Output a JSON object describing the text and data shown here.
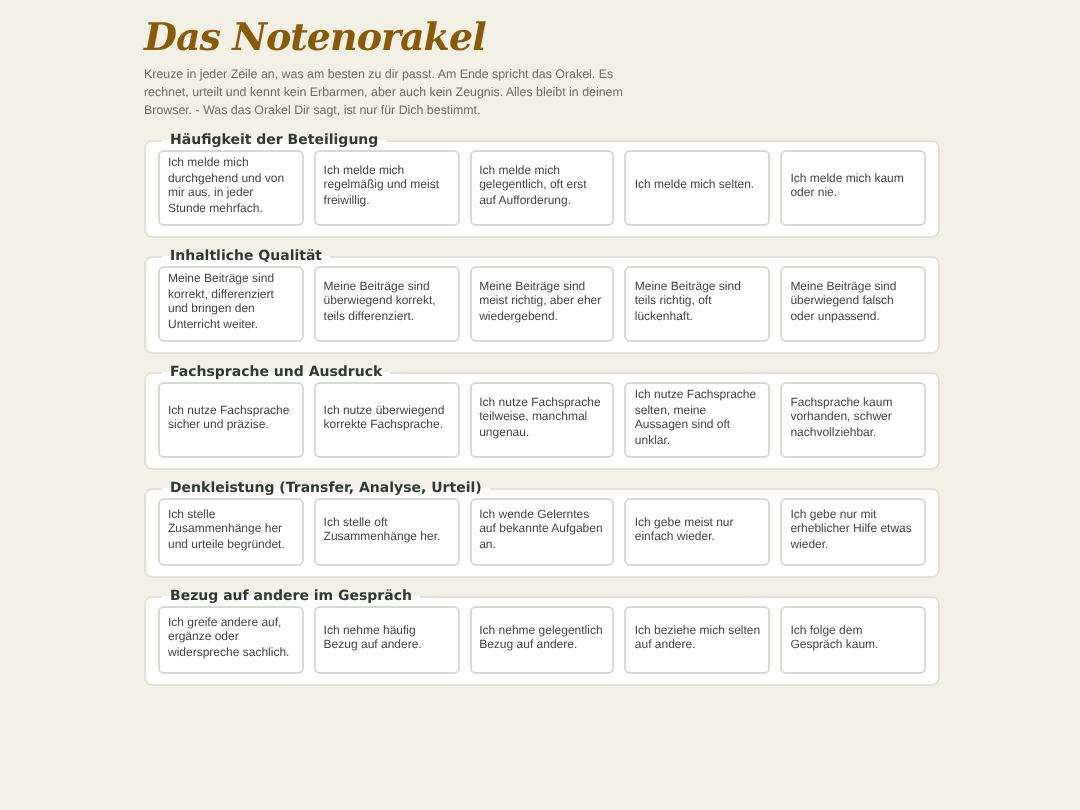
{
  "title": "Das Notenorakel",
  "intro": "Kreuze in jeder Zeile an, was am besten zu dir passt. Am Ende spricht das Orakel. Es rechnet, urteilt und kennt kein Erbarmen, aber auch kein Zeugnis. Alles bleibt in deinem Browser. - Was das Orakel Dir sagt, ist nur für Dich bestimmt.",
  "sections": [
    {
      "legend": "Häufigkeit der Beteiligung",
      "options": [
        {
          "text": "Ich melde mich durchgehend und von mir aus, in jeder Stunde mehrfach.",
          "selected": false
        },
        {
          "text": "Ich melde mich regelmäßig und meist freiwillig.",
          "selected": false
        },
        {
          "text": "Ich melde mich gelegentlich, oft erst auf Aufforderung.",
          "selected": false
        },
        {
          "text": "Ich melde mich selten.",
          "selected": false
        },
        {
          "text": "Ich melde mich kaum oder nie.",
          "selected": false
        }
      ]
    },
    {
      "legend": "Inhaltliche Qualität",
      "options": [
        {
          "text": "Meine Beiträge sind korrekt, differenziert und bringen den Unterricht weiter.",
          "selected": false
        },
        {
          "text": "Meine Beiträge sind überwiegend korrekt, teils differenziert.",
          "selected": false
        },
        {
          "text": "Meine Beiträge sind meist richtig, aber eher wiedergebend.",
          "selected": false
        },
        {
          "text": "Meine Beiträge sind teils richtig, oft lückenhaft.",
          "selected": false
        },
        {
          "text": "Meine Beiträge sind überwiegend falsch oder unpassend.",
          "selected": false
        }
      ]
    },
    {
      "legend": "Fachsprache und Ausdruck",
      "options": [
        {
          "text": "Ich nutze Fachsprache sicher und präzise.",
          "selected": false
        },
        {
          "text": "Ich nutze überwiegend korrekte Fachsprache.",
          "selected": false
        },
        {
          "text": "Ich nutze Fachsprache teilweise, manchmal ungenau.",
          "selected": false
        },
        {
          "text": "Ich nutze Fachsprache selten, meine Aussagen sind oft unklar.",
          "selected": false
        },
        {
          "text": "Fachsprache kaum vorhanden, schwer nachvollziehbar.",
          "selected": false
        }
      ]
    },
    {
      "legend": "Denkleistung (Transfer, Analyse, Urteil)",
      "options": [
        {
          "text": "Ich stelle Zusammenhänge her und urteile begründet.",
          "selected": false
        },
        {
          "text": "Ich stelle oft Zusammenhänge her.",
          "selected": false
        },
        {
          "text": "Ich wende Gelerntes auf bekannte Aufgaben an.",
          "selected": false
        },
        {
          "text": "Ich gebe meist nur einfach wieder.",
          "selected": false
        },
        {
          "text": "Ich gebe nur mit erheblicher Hilfe etwas wieder.",
          "selected": false
        }
      ]
    },
    {
      "legend": "Bezug auf andere im Gespräch",
      "options": [
        {
          "text": "Ich greife andere auf, ergänze oder widerspreche sachlich.",
          "selected": false
        },
        {
          "text": "Ich nehme häufig Bezug auf andere.",
          "selected": false
        },
        {
          "text": "Ich nehme gelegentlich Bezug auf andere.",
          "selected": false
        },
        {
          "text": "Ich beziehe mich selten auf andere.",
          "selected": false
        },
        {
          "text": "Ich folge dem Gespräch kaum.",
          "selected": false
        }
      ]
    }
  ]
}
